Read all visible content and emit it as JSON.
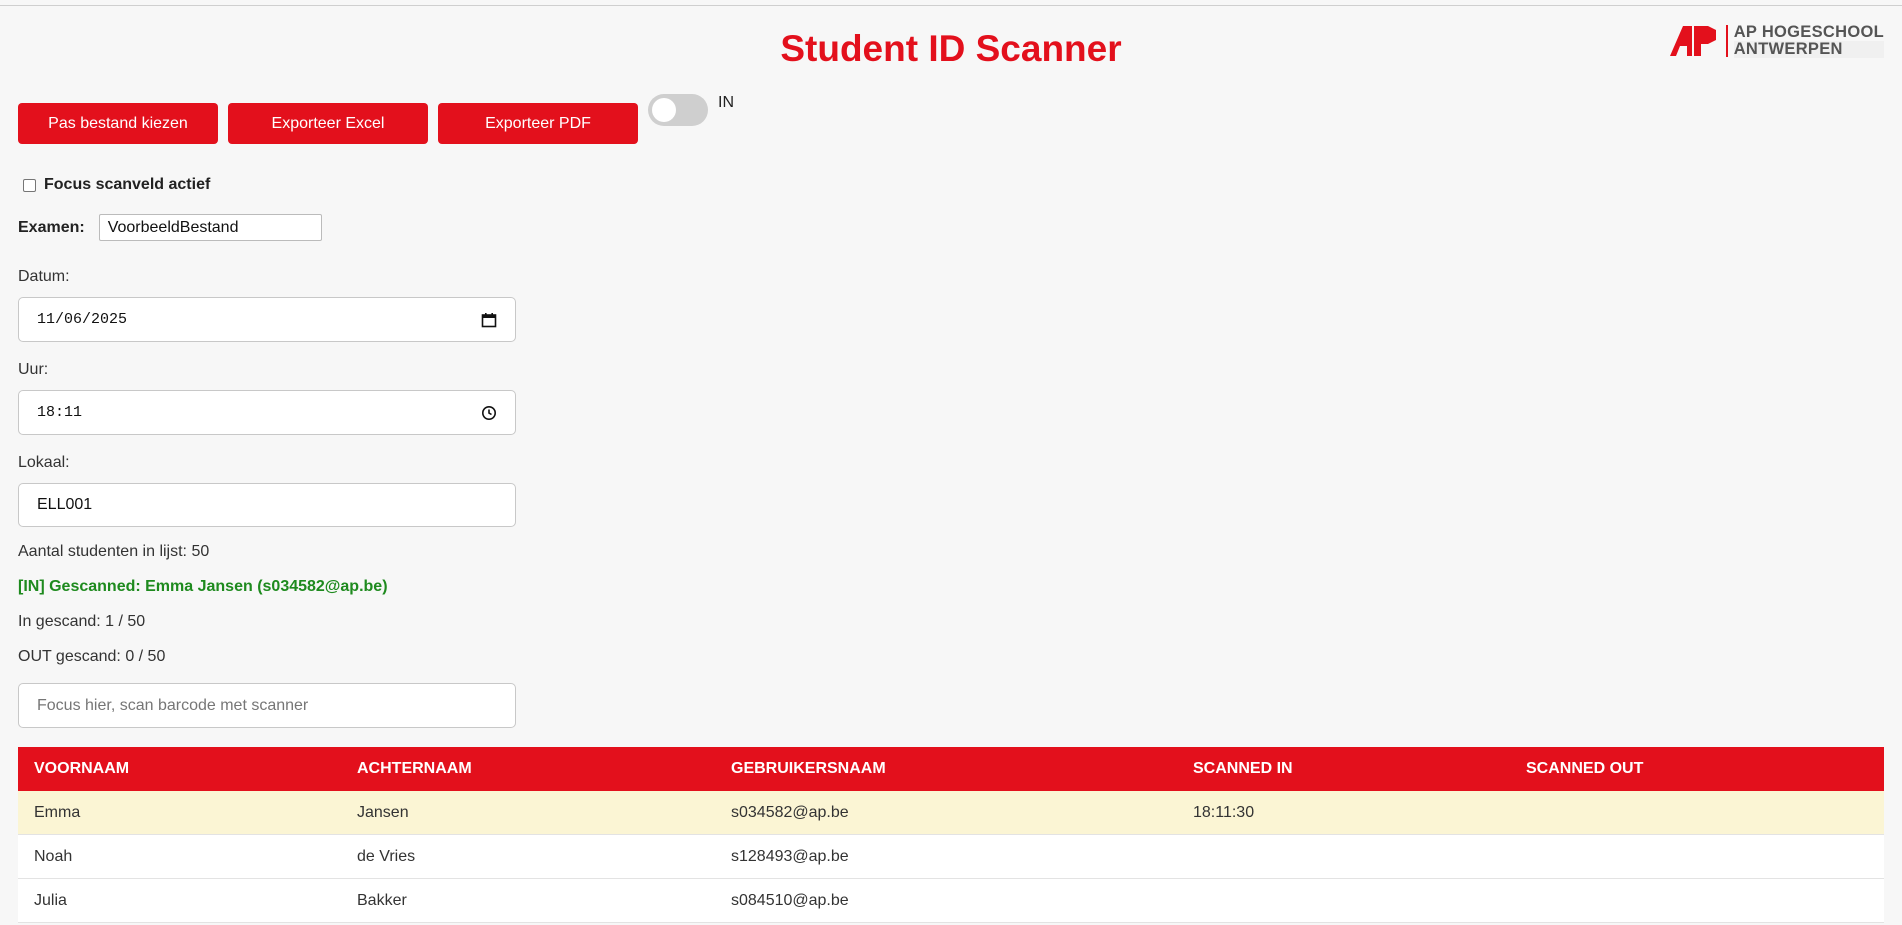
{
  "header": {
    "title": "Student ID Scanner",
    "logo_line1": "AP HOGESCHOOL",
    "logo_line2": "ANTWERPEN",
    "brand_color": "#e3101c"
  },
  "toolbar": {
    "choose_file_label": "Pas bestand kiezen",
    "export_excel_label": "Exporteer Excel",
    "export_pdf_label": "Exporteer PDF",
    "mode_toggle_state": "off",
    "mode_label": "IN"
  },
  "focus_checkbox": {
    "label": "Focus scanveld actief",
    "checked": false
  },
  "examen": {
    "label": "Examen:",
    "value": "VoorbeeldBestand"
  },
  "datum": {
    "label": "Datum:",
    "value": "11/06/2025",
    "icon": "calendar-icon"
  },
  "uur": {
    "label": "Uur:",
    "value": "18:11",
    "icon": "clock-icon"
  },
  "lokaal": {
    "label": "Lokaal:",
    "value": "ELL001"
  },
  "stats": {
    "count_text": "Aantal studenten in lijst: 50",
    "last_scan": "[IN] Gescanned: Emma Jansen (s034582@ap.be)",
    "in_text": "In gescand: 1 / 50",
    "out_text": "OUT gescand: 0 / 50",
    "success_color": "#1e8a1e"
  },
  "scan_input": {
    "placeholder": "Focus hier, scan barcode met scanner",
    "value": ""
  },
  "table": {
    "headers": [
      "VOORNAAM",
      "ACHTERNAAM",
      "GEBRUIKERSNAAM",
      "SCANNED IN",
      "SCANNED OUT"
    ],
    "rows": [
      {
        "voornaam": "Emma",
        "achternaam": "Jansen",
        "gebruikersnaam": "s034582@ap.be",
        "scanned_in": "18:11:30",
        "scanned_out": "",
        "highlight": true
      },
      {
        "voornaam": "Noah",
        "achternaam": "de Vries",
        "gebruikersnaam": "s128493@ap.be",
        "scanned_in": "",
        "scanned_out": "",
        "highlight": false
      },
      {
        "voornaam": "Julia",
        "achternaam": "Bakker",
        "gebruikersnaam": "s084510@ap.be",
        "scanned_in": "",
        "scanned_out": "",
        "highlight": false
      }
    ]
  }
}
